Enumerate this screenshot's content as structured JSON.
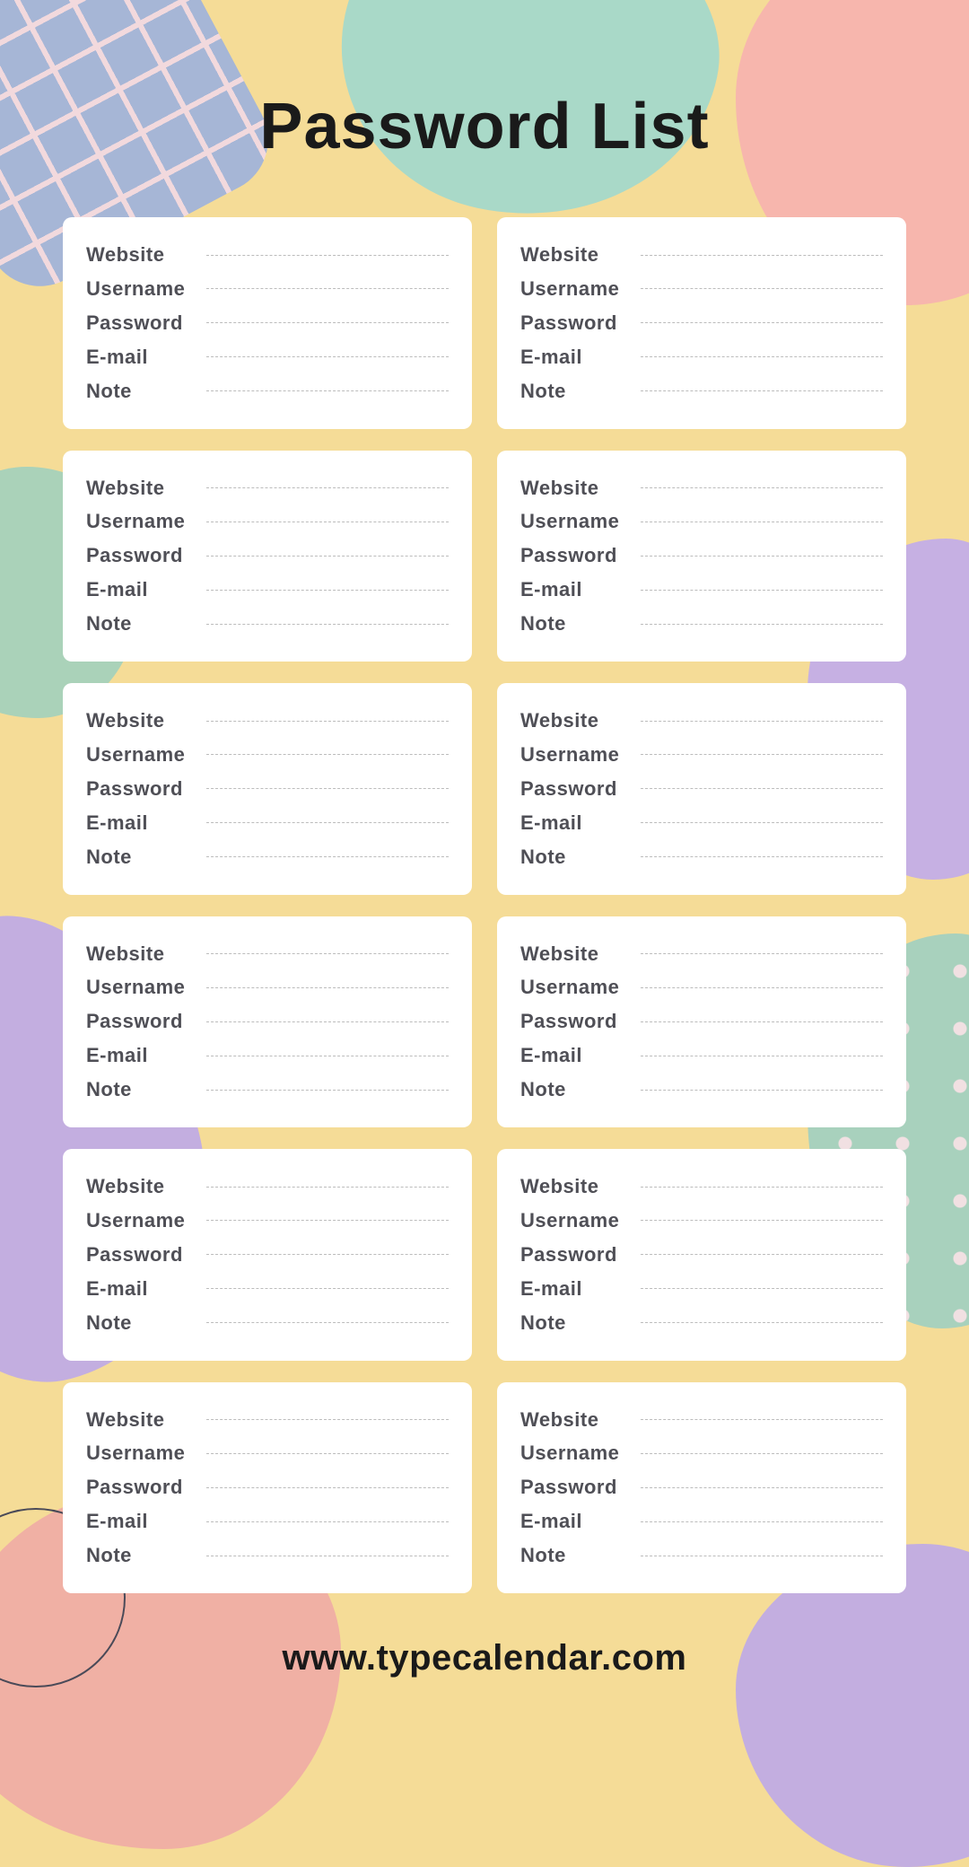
{
  "title": "Password List",
  "footer": "www.typecalendar.com",
  "fields": {
    "website": "Website",
    "username": "Username",
    "password": "Password",
    "email": "E-mail",
    "note": "Note"
  },
  "card_count": 12
}
